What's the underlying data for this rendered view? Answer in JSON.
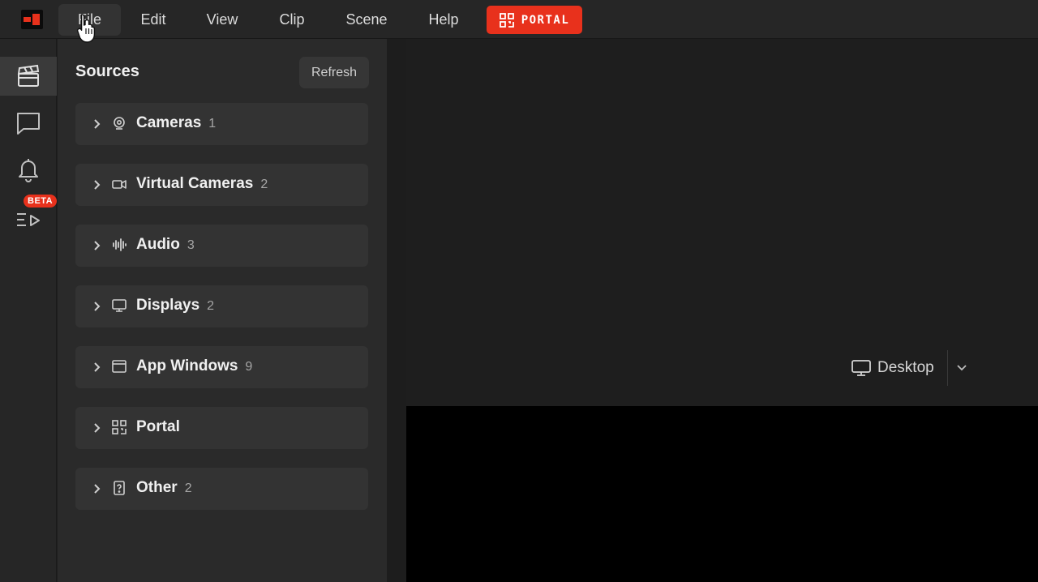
{
  "app": {
    "logo": "app-logo-icon",
    "accent_color": "#e8311c"
  },
  "menu": {
    "items": [
      {
        "label": "File"
      },
      {
        "label": "Edit"
      },
      {
        "label": "View"
      },
      {
        "label": "Clip"
      },
      {
        "label": "Scene"
      },
      {
        "label": "Help"
      }
    ],
    "active_index": 0,
    "portal_button": {
      "label": "PORTAL",
      "icon": "portal-icon"
    }
  },
  "rail": {
    "items": [
      {
        "name": "scenes",
        "icon": "clapperboard-icon",
        "active": true
      },
      {
        "name": "chat",
        "icon": "chat-bubble-icon",
        "active": false
      },
      {
        "name": "notifications",
        "icon": "bell-icon",
        "active": false
      },
      {
        "name": "playlist",
        "icon": "playlist-icon",
        "active": false
      }
    ],
    "beta_badge": "BETA"
  },
  "sources": {
    "title": "Sources",
    "refresh_label": "Refresh",
    "groups": [
      {
        "label": "Cameras",
        "count": "1",
        "icon": "webcam-icon"
      },
      {
        "label": "Virtual Cameras",
        "count": "2",
        "icon": "video-camera-icon"
      },
      {
        "label": "Audio",
        "count": "3",
        "icon": "waveform-icon"
      },
      {
        "label": "Displays",
        "count": "2",
        "icon": "monitor-icon"
      },
      {
        "label": "App Windows",
        "count": "9",
        "icon": "app-window-icon"
      },
      {
        "label": "Portal",
        "count": "",
        "icon": "portal-icon"
      },
      {
        "label": "Other",
        "count": "2",
        "icon": "question-file-icon"
      }
    ]
  },
  "preview": {
    "display_select": {
      "value": "Desktop",
      "icon": "monitor-icon"
    }
  }
}
